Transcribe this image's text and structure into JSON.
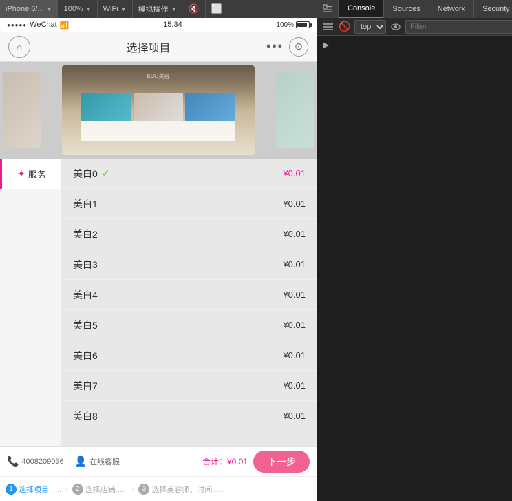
{
  "toolbar": {
    "device_label": "iPhone 6/...",
    "zoom_label": "100%",
    "network_label": "WiFi",
    "action_label": "模拟操作",
    "icons": {
      "mute": "🔇",
      "fullscreen": "⛶",
      "inspect": "⬚"
    }
  },
  "devtools": {
    "tabs": [
      {
        "id": "console",
        "label": "Console",
        "active": true
      },
      {
        "id": "sources",
        "label": "Sources",
        "active": false
      },
      {
        "id": "network",
        "label": "Network",
        "active": false
      },
      {
        "id": "security",
        "label": "Security",
        "active": false
      }
    ],
    "console_toolbar": {
      "clear_label": "🚫",
      "top_select": "top",
      "filter_placeholder": "Filter"
    }
  },
  "phone": {
    "status_bar": {
      "signal": "●●●●●",
      "carrier": "WeChat",
      "wifi": "WiFi",
      "time": "15:34",
      "battery_pct": "100%"
    },
    "nav": {
      "title": "选择项目",
      "home_icon": "⌂",
      "more_icon": "•••",
      "record_icon": "⊙"
    },
    "sidebar": {
      "items": [
        {
          "id": "fuwu",
          "label": "服务",
          "icon": "✦",
          "active": true
        }
      ]
    },
    "services": [
      {
        "name": "美白0",
        "price": "¥0.01",
        "selected": true
      },
      {
        "name": "美白1",
        "price": "¥0.01",
        "selected": false
      },
      {
        "name": "美白2",
        "price": "¥0.01",
        "selected": false
      },
      {
        "name": "美白3",
        "price": "¥0.01",
        "selected": false
      },
      {
        "name": "美白4",
        "price": "¥0.01",
        "selected": false
      },
      {
        "name": "美白5",
        "price": "¥0.01",
        "selected": false
      },
      {
        "name": "美白6",
        "price": "¥0.01",
        "selected": false
      },
      {
        "name": "美白7",
        "price": "¥0.01",
        "selected": false
      },
      {
        "name": "美白8",
        "price": "¥0.01",
        "selected": false
      }
    ],
    "bottom_bar": {
      "phone": "4008209036",
      "service_label": "在线客服",
      "total_label": "合计：",
      "total_value": "¥0.01",
      "next_btn": "下一步"
    },
    "steps": [
      {
        "num": "1",
        "label": "选择项目......"
      },
      {
        "num": "2",
        "label": "选择店铺......"
      },
      {
        "num": "3",
        "label": "选择美容师、时间......"
      }
    ]
  }
}
